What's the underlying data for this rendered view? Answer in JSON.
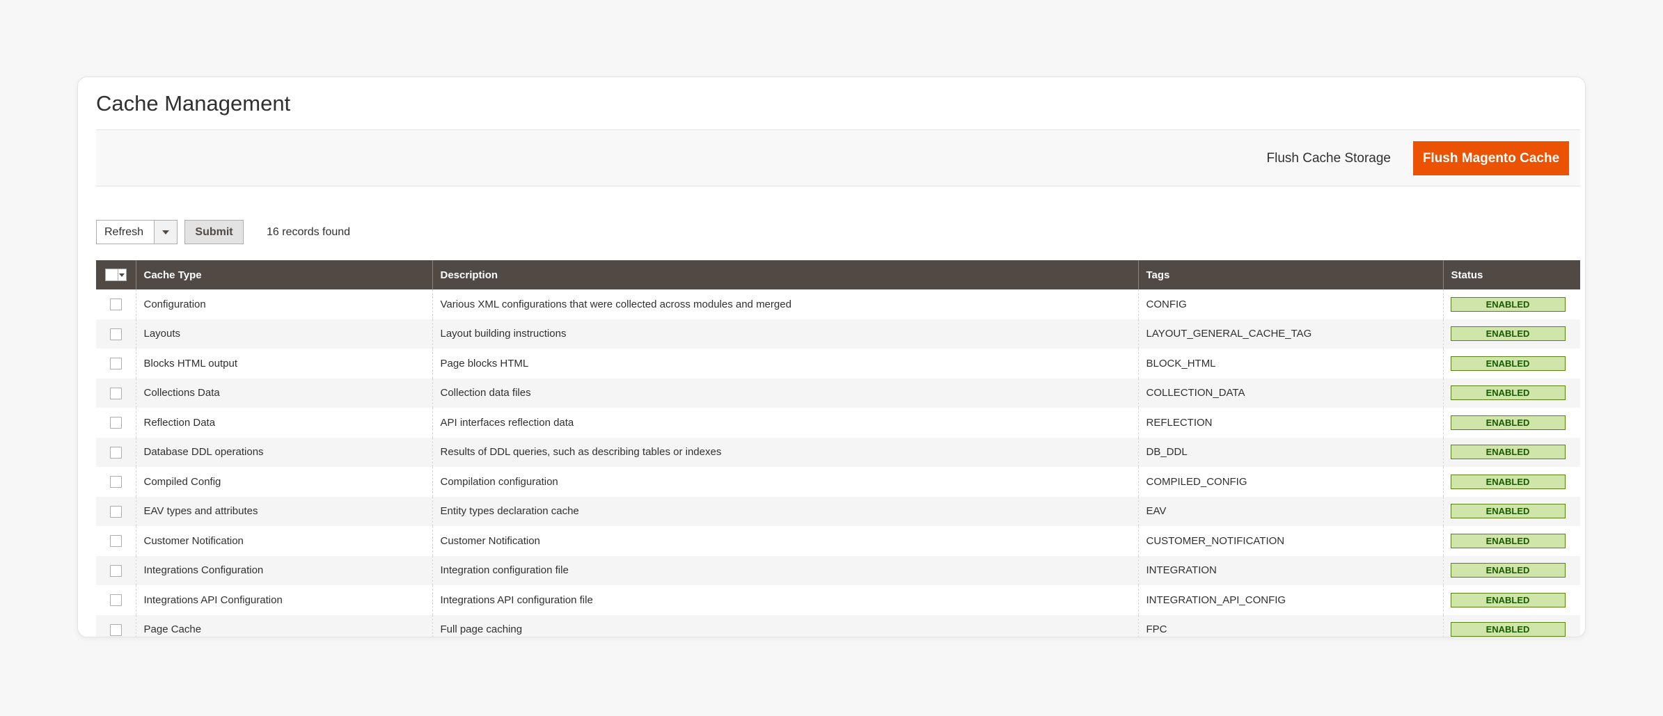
{
  "page": {
    "title": "Cache Management"
  },
  "actions": {
    "flush_storage_label": "Flush Cache Storage",
    "flush_magento_label": "Flush Magento Cache"
  },
  "toolbar": {
    "action_select_value": "Refresh",
    "submit_label": "Submit",
    "records_found": "16 records found"
  },
  "grid": {
    "columns": {
      "cache_type": "Cache Type",
      "description": "Description",
      "tags": "Tags",
      "status": "Status"
    },
    "rows": [
      {
        "cache_type": "Configuration",
        "description": "Various XML configurations that were collected across modules and merged",
        "tags": "CONFIG",
        "status": "ENABLED"
      },
      {
        "cache_type": "Layouts",
        "description": "Layout building instructions",
        "tags": "LAYOUT_GENERAL_CACHE_TAG",
        "status": "ENABLED"
      },
      {
        "cache_type": "Blocks HTML output",
        "description": "Page blocks HTML",
        "tags": "BLOCK_HTML",
        "status": "ENABLED"
      },
      {
        "cache_type": "Collections Data",
        "description": "Collection data files",
        "tags": "COLLECTION_DATA",
        "status": "ENABLED"
      },
      {
        "cache_type": "Reflection Data",
        "description": "API interfaces reflection data",
        "tags": "REFLECTION",
        "status": "ENABLED"
      },
      {
        "cache_type": "Database DDL operations",
        "description": "Results of DDL queries, such as describing tables or indexes",
        "tags": "DB_DDL",
        "status": "ENABLED"
      },
      {
        "cache_type": "Compiled Config",
        "description": "Compilation configuration",
        "tags": "COMPILED_CONFIG",
        "status": "ENABLED"
      },
      {
        "cache_type": "EAV types and attributes",
        "description": "Entity types declaration cache",
        "tags": "EAV",
        "status": "ENABLED"
      },
      {
        "cache_type": "Customer Notification",
        "description": "Customer Notification",
        "tags": "CUSTOMER_NOTIFICATION",
        "status": "ENABLED"
      },
      {
        "cache_type": "Integrations Configuration",
        "description": "Integration configuration file",
        "tags": "INTEGRATION",
        "status": "ENABLED"
      },
      {
        "cache_type": "Integrations API Configuration",
        "description": "Integrations API configuration file",
        "tags": "INTEGRATION_API_CONFIG",
        "status": "ENABLED"
      },
      {
        "cache_type": "Page Cache",
        "description": "Full page caching",
        "tags": "FPC",
        "status": "ENABLED"
      }
    ]
  },
  "colors": {
    "accent": "#eb5202",
    "header_bg": "#514943",
    "enabled_bg": "#d0e5a9",
    "enabled_border": "#5b8116",
    "enabled_text": "#185b00"
  },
  "icons": {
    "select_arrow": "chevron-down-icon",
    "mass_action_arrow": "chevron-down-icon"
  }
}
